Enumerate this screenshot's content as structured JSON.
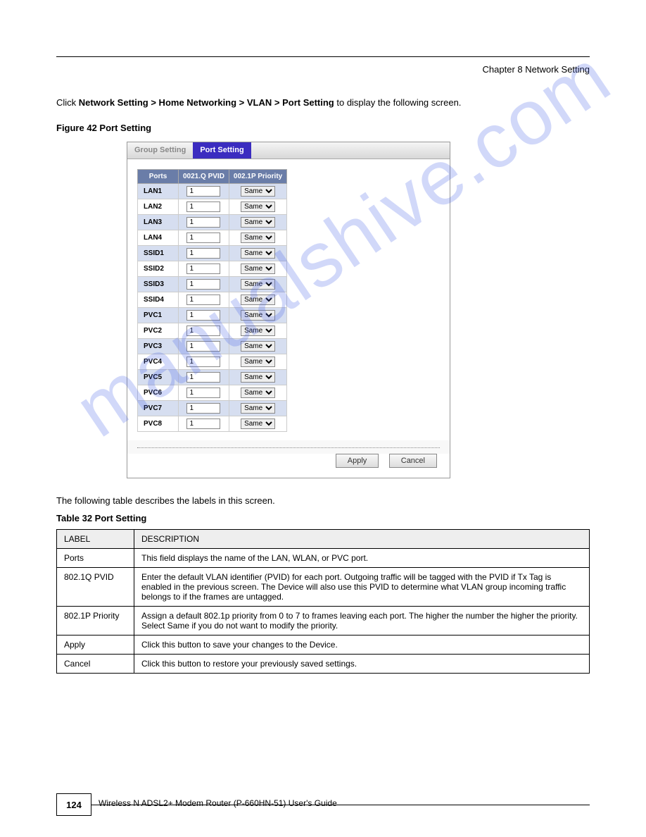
{
  "header": {
    "chapter": "Chapter 8 Network Setting"
  },
  "intro": {
    "pre": "Click ",
    "strong1": "Network Setting > Home Networking > VLAN > Port Setting",
    "post": " to display the following screen."
  },
  "figure_title": "Figure 42   Port Setting",
  "tabs": {
    "group": "Group Setting",
    "port": "Port Setting"
  },
  "cfg": {
    "headers": [
      "Ports",
      "0021.Q PVID",
      "002.1P Priority"
    ],
    "rows": [
      {
        "port": "LAN1",
        "pvid": "1",
        "prio": "Same"
      },
      {
        "port": "LAN2",
        "pvid": "1",
        "prio": "Same"
      },
      {
        "port": "LAN3",
        "pvid": "1",
        "prio": "Same"
      },
      {
        "port": "LAN4",
        "pvid": "1",
        "prio": "Same"
      },
      {
        "port": "SSID1",
        "pvid": "1",
        "prio": "Same"
      },
      {
        "port": "SSID2",
        "pvid": "1",
        "prio": "Same"
      },
      {
        "port": "SSID3",
        "pvid": "1",
        "prio": "Same"
      },
      {
        "port": "SSID4",
        "pvid": "1",
        "prio": "Same"
      },
      {
        "port": "PVC1",
        "pvid": "1",
        "prio": "Same"
      },
      {
        "port": "PVC2",
        "pvid": "1",
        "prio": "Same"
      },
      {
        "port": "PVC3",
        "pvid": "1",
        "prio": "Same"
      },
      {
        "port": "PVC4",
        "pvid": "1",
        "prio": "Same"
      },
      {
        "port": "PVC5",
        "pvid": "1",
        "prio": "Same"
      },
      {
        "port": "PVC6",
        "pvid": "1",
        "prio": "Same"
      },
      {
        "port": "PVC7",
        "pvid": "1",
        "prio": "Same"
      },
      {
        "port": "PVC8",
        "pvid": "1",
        "prio": "Same"
      }
    ]
  },
  "buttons": {
    "apply": "Apply",
    "cancel": "Cancel"
  },
  "desc_line": "The following table describes the labels in this screen.",
  "table_title": "Table 32   Port Setting",
  "desc_table": {
    "head_label": "LABEL",
    "head_desc": "DESCRIPTION",
    "rows": [
      {
        "label": "Ports",
        "desc": "This field displays the name of the LAN, WLAN, or PVC port."
      },
      {
        "label": "802.1Q PVID",
        "desc": "Enter the default VLAN identifier (PVID) for each port. Outgoing traffic will be tagged with the PVID if Tx Tag is enabled in the previous screen. The Device will also use this PVID to determine what VLAN group incoming traffic belongs to if the frames are untagged."
      },
      {
        "label": "802.1P Priority",
        "desc": "Assign a default 802.1p priority from 0 to 7 to frames leaving each port. The higher the number the higher the priority. Select Same if you do not want to modify the priority."
      },
      {
        "label": "Apply",
        "desc": "Click this button to save your changes to the Device."
      },
      {
        "label": "Cancel",
        "desc": "Click this button to restore your previously saved settings."
      }
    ]
  },
  "footer": {
    "page": "124",
    "guide": "Wireless N ADSL2+ Modem Router (P-660HN-51) User's Guide"
  },
  "watermark": "manualshive.com"
}
